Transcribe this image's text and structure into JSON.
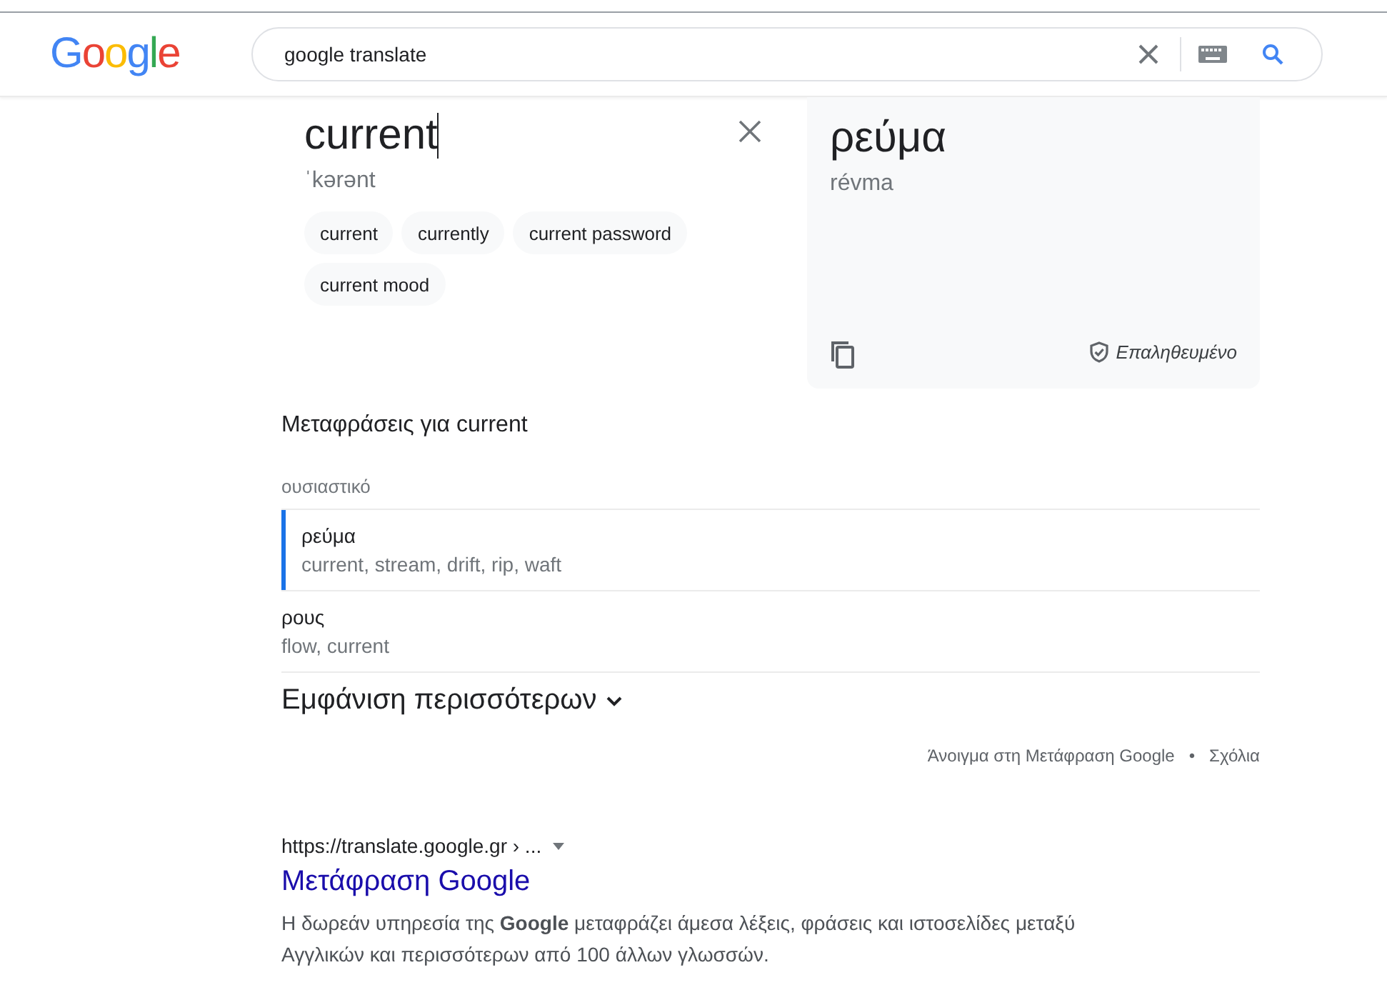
{
  "header": {
    "logo": "Google",
    "search": {
      "value": "google translate"
    }
  },
  "translator": {
    "source": {
      "text": "current",
      "phonetic": "ˈkərənt"
    },
    "suggestions": [
      "current",
      "currently",
      "current password",
      "current mood"
    ],
    "target": {
      "text": "ρεύμα",
      "transliteration": "révma",
      "verified": "Επαληθευμένο"
    }
  },
  "translations": {
    "title": "Μεταφράσεις για current",
    "part_of_speech": "ουσιαστικό",
    "entries": [
      {
        "word": "ρεύμα",
        "meanings": "current, stream, drift, rip, waft",
        "selected": true
      },
      {
        "word": "ρους",
        "meanings": "flow, current",
        "selected": false
      }
    ],
    "more": "Εμφάνιση περισσότερων",
    "links": [
      "Άνοιγμα στη Μετάφραση Google",
      "•",
      "Σχόλια"
    ]
  },
  "result": {
    "url": "https://translate.google.gr › ...",
    "title": "Μετάφραση Google",
    "snippet": "Η δωρεάν υπηρεσία της **Google** μεταφράζει άμεσα λέξεις, φράσεις και ιστοσελίδες μεταξύ Αγγλικών και περισσότερων από 100 άλλων γλωσσών."
  }
}
